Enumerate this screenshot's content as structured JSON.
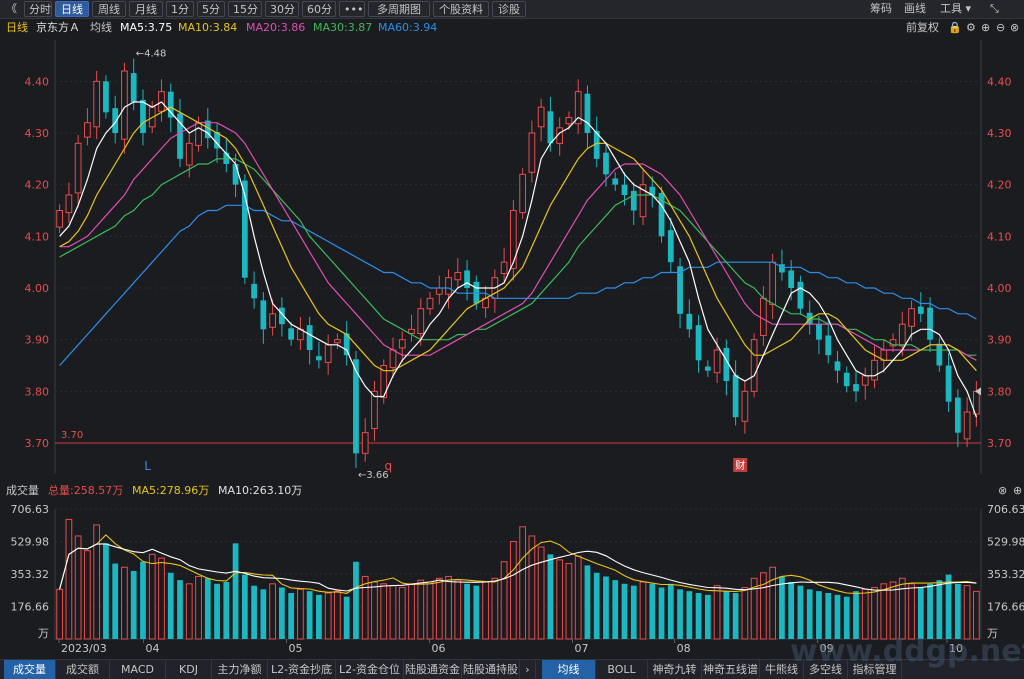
{
  "toolbar": {
    "back": "《",
    "tabs": [
      "分时",
      "日线",
      "周线",
      "月线",
      "1分",
      "5分",
      "15分",
      "30分",
      "60分",
      "•••",
      "多周期图",
      "个股资料",
      "诊股"
    ],
    "active_tab": "日线",
    "right": [
      "筹码",
      "画线",
      "工具 ▾"
    ]
  },
  "info": {
    "period": "日线",
    "name": "京东方Ａ",
    "avg": "均线",
    "ma5": "MA5:3.75",
    "ma10": "MA10:3.84",
    "ma20": "MA20:3.86",
    "ma30": "MA30:3.87",
    "ma60": "MA60:3.94",
    "fuquan": "前复权"
  },
  "colors": {
    "up": "#e84c4c",
    "down": "#1bb8c2",
    "ma5": "#ffffff",
    "ma10": "#e8c41b",
    "ma20": "#e04fb4",
    "ma30": "#3fb85a",
    "ma60": "#2d8ee8",
    "support": "#d23838"
  },
  "volinfo": {
    "title": "成交量",
    "total": "总量:258.57万",
    "ma5": "MA5:278.96万",
    "ma10": "MA10:263.10万"
  },
  "tabs_bottom": [
    "成交量",
    "成交额",
    "MACD",
    "KDJ",
    "主力净额",
    "L2-资金抄底",
    "L2-资金仓位",
    "陆股通资金",
    "陆股通持股",
    "均线",
    "BOLL",
    "神奇九转",
    "神奇五线谱",
    "牛熊线",
    "多空线",
    "指标管理"
  ],
  "watermark": "www.ddgp.net",
  "chart_data": {
    "type": "candlestick",
    "y_ticks": [
      "4.40",
      "4.30",
      "4.20",
      "4.10",
      "4.00",
      "3.90",
      "3.80",
      "3.70"
    ],
    "ylim": [
      3.64,
      4.48
    ],
    "support_line": {
      "value": 3.7,
      "label": "3.70"
    },
    "high_label": "←4.48",
    "low_label": "←3.66",
    "last_price_marker": "3.80",
    "x_months": [
      "2023/03",
      "04",
      "05",
      "06",
      "07",
      "08",
      "09",
      "10"
    ],
    "markers": [
      "L",
      "q",
      "财"
    ],
    "volume_ticks": [
      "706.63",
      "529.98",
      "353.32",
      "176.66",
      "万"
    ],
    "volume_ylim": [
      0,
      706.63
    ],
    "close": [
      4.15,
      4.18,
      4.28,
      4.32,
      4.4,
      4.34,
      4.3,
      4.42,
      4.36,
      4.3,
      4.35,
      4.38,
      4.33,
      4.25,
      4.28,
      4.32,
      4.29,
      4.27,
      4.24,
      4.2,
      4.02,
      3.98,
      3.92,
      3.95,
      3.93,
      3.9,
      3.92,
      3.88,
      3.86,
      3.89,
      3.9,
      3.87,
      3.68,
      3.72,
      3.8,
      3.85,
      3.88,
      3.9,
      3.92,
      3.96,
      3.98,
      4.0,
      4.02,
      4.03,
      4.0,
      3.97,
      3.98,
      4.02,
      4.05,
      4.15,
      4.22,
      4.3,
      4.35,
      4.28,
      4.31,
      4.33,
      4.38,
      4.3,
      4.25,
      4.22,
      4.2,
      4.18,
      4.15,
      4.2,
      4.18,
      4.1,
      4.05,
      3.95,
      3.92,
      3.86,
      3.84,
      3.88,
      3.82,
      3.75,
      3.8,
      3.9,
      3.98,
      4.05,
      4.03,
      4.0,
      3.96,
      3.93,
      3.9,
      3.87,
      3.84,
      3.81,
      3.8,
      3.83,
      3.86,
      3.88,
      3.9,
      3.93,
      3.96,
      3.95,
      3.9,
      3.85,
      3.78,
      3.72,
      3.76,
      3.8
    ],
    "volume": [
      270,
      650,
      560,
      480,
      620,
      520,
      410,
      390,
      370,
      420,
      460,
      440,
      360,
      320,
      300,
      340,
      330,
      300,
      310,
      520,
      350,
      290,
      270,
      300,
      280,
      250,
      270,
      260,
      240,
      250,
      260,
      230,
      420,
      340,
      310,
      300,
      290,
      280,
      300,
      320,
      310,
      330,
      340,
      320,
      300,
      290,
      310,
      330,
      420,
      530,
      610,
      560,
      500,
      460,
      430,
      410,
      450,
      400,
      360,
      340,
      320,
      300,
      290,
      310,
      300,
      280,
      300,
      270,
      260,
      250,
      240,
      290,
      260,
      250,
      280,
      330,
      360,
      390,
      340,
      310,
      290,
      270,
      260,
      250,
      240,
      230,
      260,
      270,
      280,
      300,
      310,
      330,
      300,
      280,
      300,
      320,
      350,
      300,
      290,
      259
    ],
    "ma5": [
      4.1,
      4.12,
      4.16,
      4.21,
      4.27,
      4.3,
      4.32,
      4.35,
      4.36,
      4.36,
      4.35,
      4.36,
      4.34,
      4.32,
      4.3,
      4.31,
      4.3,
      4.28,
      4.26,
      4.24,
      4.18,
      4.1,
      4.03,
      3.97,
      3.95,
      3.93,
      3.92,
      3.91,
      3.9,
      3.89,
      3.89,
      3.88,
      3.84,
      3.81,
      3.79,
      3.79,
      3.83,
      3.86,
      3.88,
      3.9,
      3.93,
      3.95,
      3.98,
      4.0,
      4.01,
      4.0,
      4.0,
      4.0,
      4.01,
      4.05,
      4.1,
      4.17,
      4.25,
      4.28,
      4.3,
      4.31,
      4.33,
      4.32,
      4.3,
      4.28,
      4.25,
      4.22,
      4.2,
      4.19,
      4.18,
      4.16,
      4.13,
      4.09,
      4.05,
      3.98,
      3.92,
      3.89,
      3.86,
      3.83,
      3.82,
      3.83,
      3.87,
      3.91,
      3.95,
      3.99,
      4.0,
      3.99,
      3.97,
      3.94,
      3.9,
      3.87,
      3.84,
      3.83,
      3.83,
      3.84,
      3.86,
      3.88,
      3.91,
      3.92,
      3.92,
      3.91,
      3.88,
      3.83,
      3.8,
      3.75
    ],
    "ma10": [
      4.08,
      4.09,
      4.11,
      4.14,
      4.18,
      4.21,
      4.24,
      4.27,
      4.3,
      4.32,
      4.33,
      4.34,
      4.35,
      4.34,
      4.33,
      4.32,
      4.31,
      4.3,
      4.29,
      4.27,
      4.24,
      4.2,
      4.16,
      4.12,
      4.08,
      4.04,
      4.01,
      3.98,
      3.95,
      3.93,
      3.92,
      3.91,
      3.89,
      3.87,
      3.85,
      3.84,
      3.84,
      3.85,
      3.86,
      3.87,
      3.88,
      3.9,
      3.92,
      3.94,
      3.96,
      3.97,
      3.98,
      3.99,
      4.0,
      4.02,
      4.04,
      4.08,
      4.12,
      4.16,
      4.19,
      4.22,
      4.25,
      4.27,
      4.28,
      4.28,
      4.27,
      4.26,
      4.25,
      4.23,
      4.21,
      4.19,
      4.16,
      4.13,
      4.1,
      4.06,
      4.02,
      3.98,
      3.95,
      3.92,
      3.89,
      3.87,
      3.87,
      3.88,
      3.89,
      3.9,
      3.92,
      3.94,
      3.95,
      3.95,
      3.94,
      3.92,
      3.9,
      3.88,
      3.87,
      3.86,
      3.86,
      3.86,
      3.87,
      3.88,
      3.89,
      3.89,
      3.89,
      3.88,
      3.86,
      3.84
    ],
    "ma20": [
      4.08,
      4.08,
      4.09,
      4.1,
      4.12,
      4.14,
      4.16,
      4.18,
      4.21,
      4.23,
      4.25,
      4.27,
      4.29,
      4.3,
      4.31,
      4.32,
      4.32,
      4.32,
      4.31,
      4.3,
      4.28,
      4.25,
      4.22,
      4.19,
      4.16,
      4.13,
      4.1,
      4.07,
      4.04,
      4.01,
      3.99,
      3.97,
      3.95,
      3.93,
      3.91,
      3.89,
      3.88,
      3.87,
      3.87,
      3.87,
      3.87,
      3.88,
      3.89,
      3.9,
      3.91,
      3.92,
      3.93,
      3.94,
      3.95,
      3.96,
      3.97,
      3.99,
      4.02,
      4.05,
      4.08,
      4.11,
      4.14,
      4.17,
      4.19,
      4.21,
      4.23,
      4.24,
      4.24,
      4.24,
      4.23,
      4.22,
      4.2,
      4.18,
      4.15,
      4.12,
      4.09,
      4.06,
      4.03,
      4.0,
      3.97,
      3.95,
      3.94,
      3.93,
      3.93,
      3.93,
      3.93,
      3.93,
      3.93,
      3.93,
      3.93,
      3.92,
      3.91,
      3.9,
      3.89,
      3.88,
      3.88,
      3.88,
      3.88,
      3.88,
      3.89,
      3.89,
      3.89,
      3.88,
      3.87,
      3.86
    ],
    "ma30": [
      4.06,
      4.07,
      4.08,
      4.09,
      4.1,
      4.11,
      4.12,
      4.14,
      4.15,
      4.17,
      4.18,
      4.2,
      4.21,
      4.22,
      4.23,
      4.24,
      4.24,
      4.25,
      4.25,
      4.25,
      4.24,
      4.23,
      4.21,
      4.19,
      4.17,
      4.15,
      4.13,
      4.1,
      4.08,
      4.06,
      4.04,
      4.02,
      4.0,
      3.98,
      3.96,
      3.94,
      3.93,
      3.92,
      3.91,
      3.9,
      3.9,
      3.9,
      3.9,
      3.91,
      3.91,
      3.92,
      3.92,
      3.93,
      3.94,
      3.95,
      3.96,
      3.97,
      3.99,
      4.01,
      4.03,
      4.05,
      4.08,
      4.1,
      4.12,
      4.14,
      4.16,
      4.17,
      4.18,
      4.18,
      4.18,
      4.17,
      4.16,
      4.15,
      4.13,
      4.11,
      4.09,
      4.07,
      4.05,
      4.03,
      4.01,
      4.0,
      3.98,
      3.97,
      3.96,
      3.95,
      3.95,
      3.94,
      3.94,
      3.93,
      3.93,
      3.92,
      3.92,
      3.91,
      3.9,
      3.9,
      3.89,
      3.89,
      3.89,
      3.88,
      3.88,
      3.88,
      3.88,
      3.88,
      3.87,
      3.87
    ],
    "ma60": [
      3.85,
      3.87,
      3.89,
      3.91,
      3.93,
      3.95,
      3.97,
      3.99,
      4.01,
      4.03,
      4.05,
      4.07,
      4.09,
      4.11,
      4.12,
      4.14,
      4.15,
      4.15,
      4.16,
      4.16,
      4.16,
      4.15,
      4.15,
      4.14,
      4.13,
      4.13,
      4.12,
      4.11,
      4.1,
      4.09,
      4.08,
      4.07,
      4.06,
      4.05,
      4.04,
      4.03,
      4.03,
      4.02,
      4.01,
      4.01,
      4.0,
      4.0,
      4.0,
      3.99,
      3.99,
      3.99,
      3.99,
      3.98,
      3.98,
      3.98,
      3.98,
      3.98,
      3.98,
      3.98,
      3.98,
      3.98,
      3.99,
      3.99,
      3.99,
      4.0,
      4.0,
      4.01,
      4.01,
      4.02,
      4.02,
      4.03,
      4.03,
      4.03,
      4.04,
      4.04,
      4.04,
      4.05,
      4.05,
      4.05,
      4.05,
      4.05,
      4.05,
      4.05,
      4.04,
      4.04,
      4.04,
      4.03,
      4.03,
      4.02,
      4.02,
      4.01,
      4.01,
      4.0,
      4.0,
      3.99,
      3.99,
      3.98,
      3.98,
      3.97,
      3.97,
      3.96,
      3.96,
      3.95,
      3.95,
      3.94
    ]
  }
}
